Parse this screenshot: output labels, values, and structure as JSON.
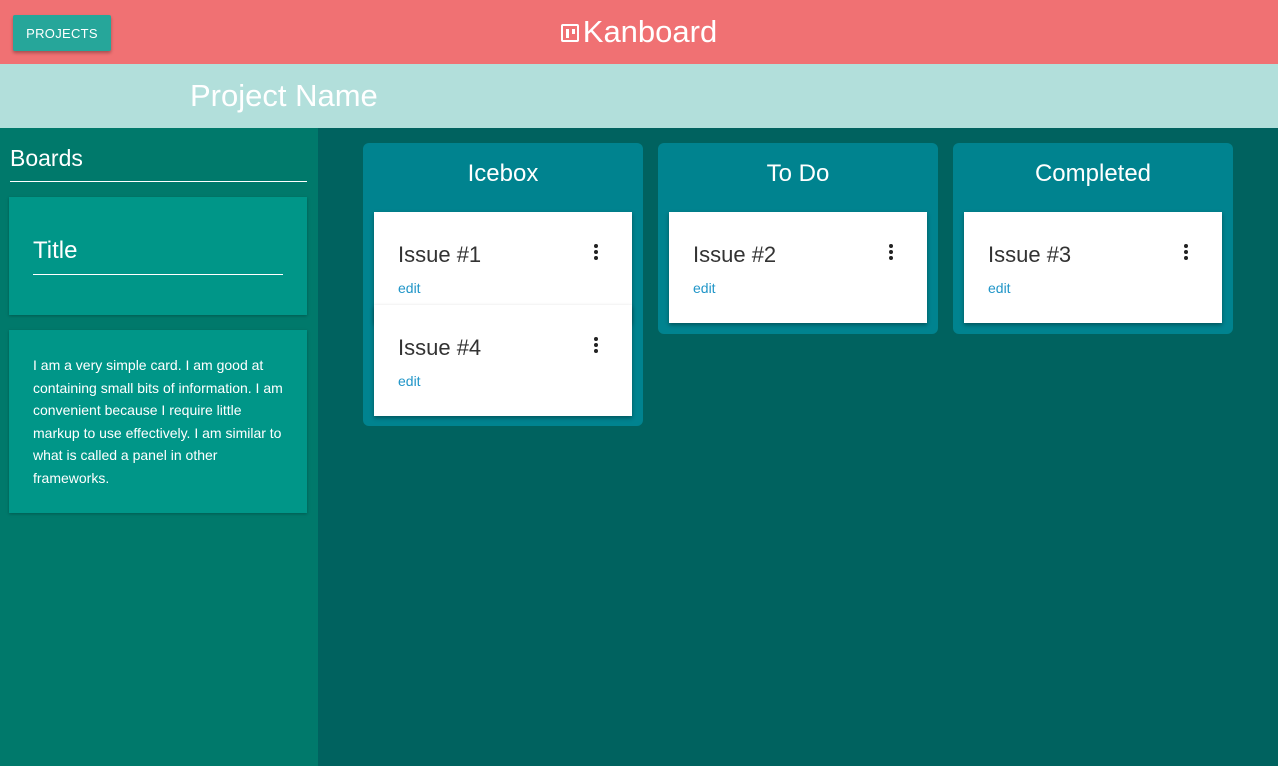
{
  "header": {
    "projects_button": "PROJECTS",
    "brand_name": "Kanboard",
    "brand_icon": "trello-board-icon",
    "accent_color": "#f07173"
  },
  "project": {
    "name": "Project Name"
  },
  "sidebar": {
    "title": "Boards",
    "title_card": {
      "text": "Title"
    },
    "info_card": {
      "text": "I am a very simple card. I am good at containing small bits of information. I am convenient because I require little markup to use effectively. I am similar to what is called a panel in other frameworks."
    }
  },
  "columns": [
    {
      "title": "Icebox",
      "issues": [
        {
          "title": "Issue #1",
          "edit": "edit",
          "menu_icon": "more-vertical-icon"
        },
        {
          "title": "Issue #4",
          "edit": "edit",
          "menu_icon": "more-vertical-icon"
        }
      ]
    },
    {
      "title": "To Do",
      "issues": [
        {
          "title": "Issue #2",
          "edit": "edit",
          "menu_icon": "more-vertical-icon"
        }
      ]
    },
    {
      "title": "Completed",
      "issues": [
        {
          "title": "Issue #3",
          "edit": "edit",
          "menu_icon": "more-vertical-icon"
        }
      ]
    }
  ]
}
